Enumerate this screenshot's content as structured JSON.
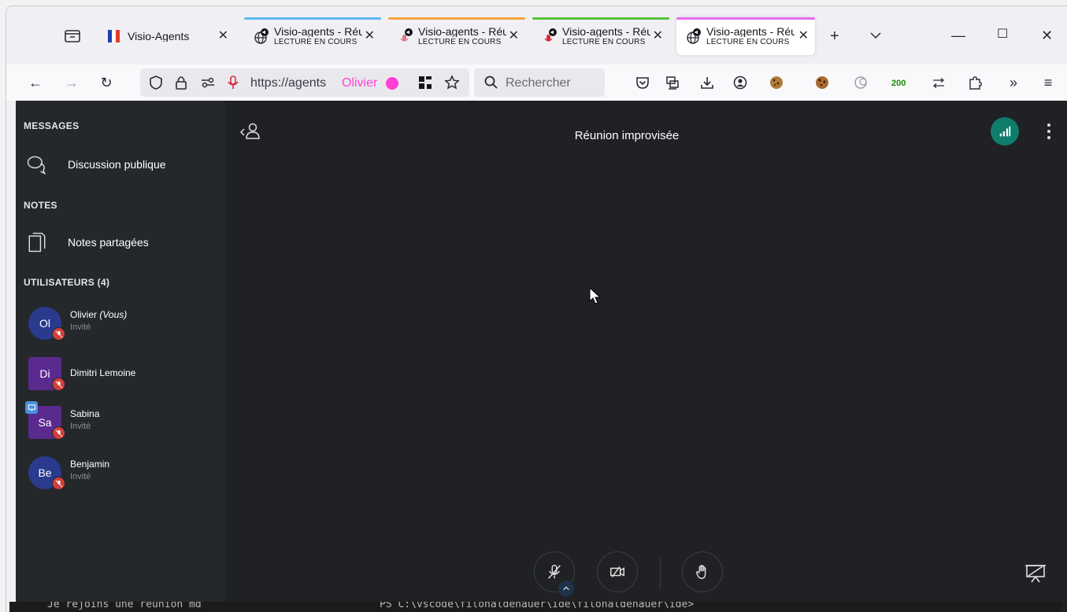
{
  "browser": {
    "tabs": [
      {
        "title": "Visio-Agents",
        "subtitle": "",
        "indicator": "",
        "active": false,
        "favicon": "french-flag-icon"
      },
      {
        "title": "Visio-agents - Réunion improvisée",
        "subtitle": "LECTURE EN COURS",
        "indicator": "#5cb8f0",
        "active": false,
        "favicon": "globe-icon"
      },
      {
        "title": "Visio-agents - Réunion improvisée",
        "subtitle": "LECTURE EN COURS",
        "indicator": "#f5a23c",
        "active": false,
        "favicon": "microphone-icon"
      },
      {
        "title": "Visio-agents - Réunion improvisée",
        "subtitle": "LECTURE EN COURS",
        "indicator": "#53c23a",
        "active": false,
        "favicon": "microphone-icon"
      },
      {
        "title": "Visio-agents - Réunion improvisée",
        "subtitle": "LECTURE EN COURS",
        "indicator": "#e56cf0",
        "active": true,
        "favicon": "globe-icon"
      }
    ],
    "url": "https://agents",
    "container_name": "Olivier",
    "container_color": "#ff3fd4",
    "search_placeholder": "Rechercher",
    "extension_badge": "200"
  },
  "sidebar": {
    "messages_header": "MESSAGES",
    "public_chat": "Discussion publique",
    "notes_header": "NOTES",
    "shared_notes": "Notes partagées",
    "users_header": "UTILISATEURS (4)",
    "users": [
      {
        "initials": "Ol",
        "name": "Olivier",
        "you": "(Vous)",
        "role": "Invité",
        "color": "#2a3a8c",
        "shape": "round",
        "presenter": false
      },
      {
        "initials": "Di",
        "name": "Dimitri Lemoine",
        "you": "",
        "role": "",
        "color": "#5b2a8f",
        "shape": "square",
        "presenter": false
      },
      {
        "initials": "Sa",
        "name": "Sabina",
        "you": "",
        "role": "Invité",
        "color": "#5b2a8f",
        "shape": "square",
        "presenter": true
      },
      {
        "initials": "Be",
        "name": "Benjamin",
        "you": "",
        "role": "Invité",
        "color": "#2a3a8c",
        "shape": "round",
        "presenter": false
      }
    ]
  },
  "meeting": {
    "title": "Réunion improvisée"
  },
  "taskbar_strip": {
    "left": "Je rejoins une réunion md",
    "right": "PS C:\\vscode\\filonaldenauer\\ide\\filonaldenauer\\ide>"
  }
}
